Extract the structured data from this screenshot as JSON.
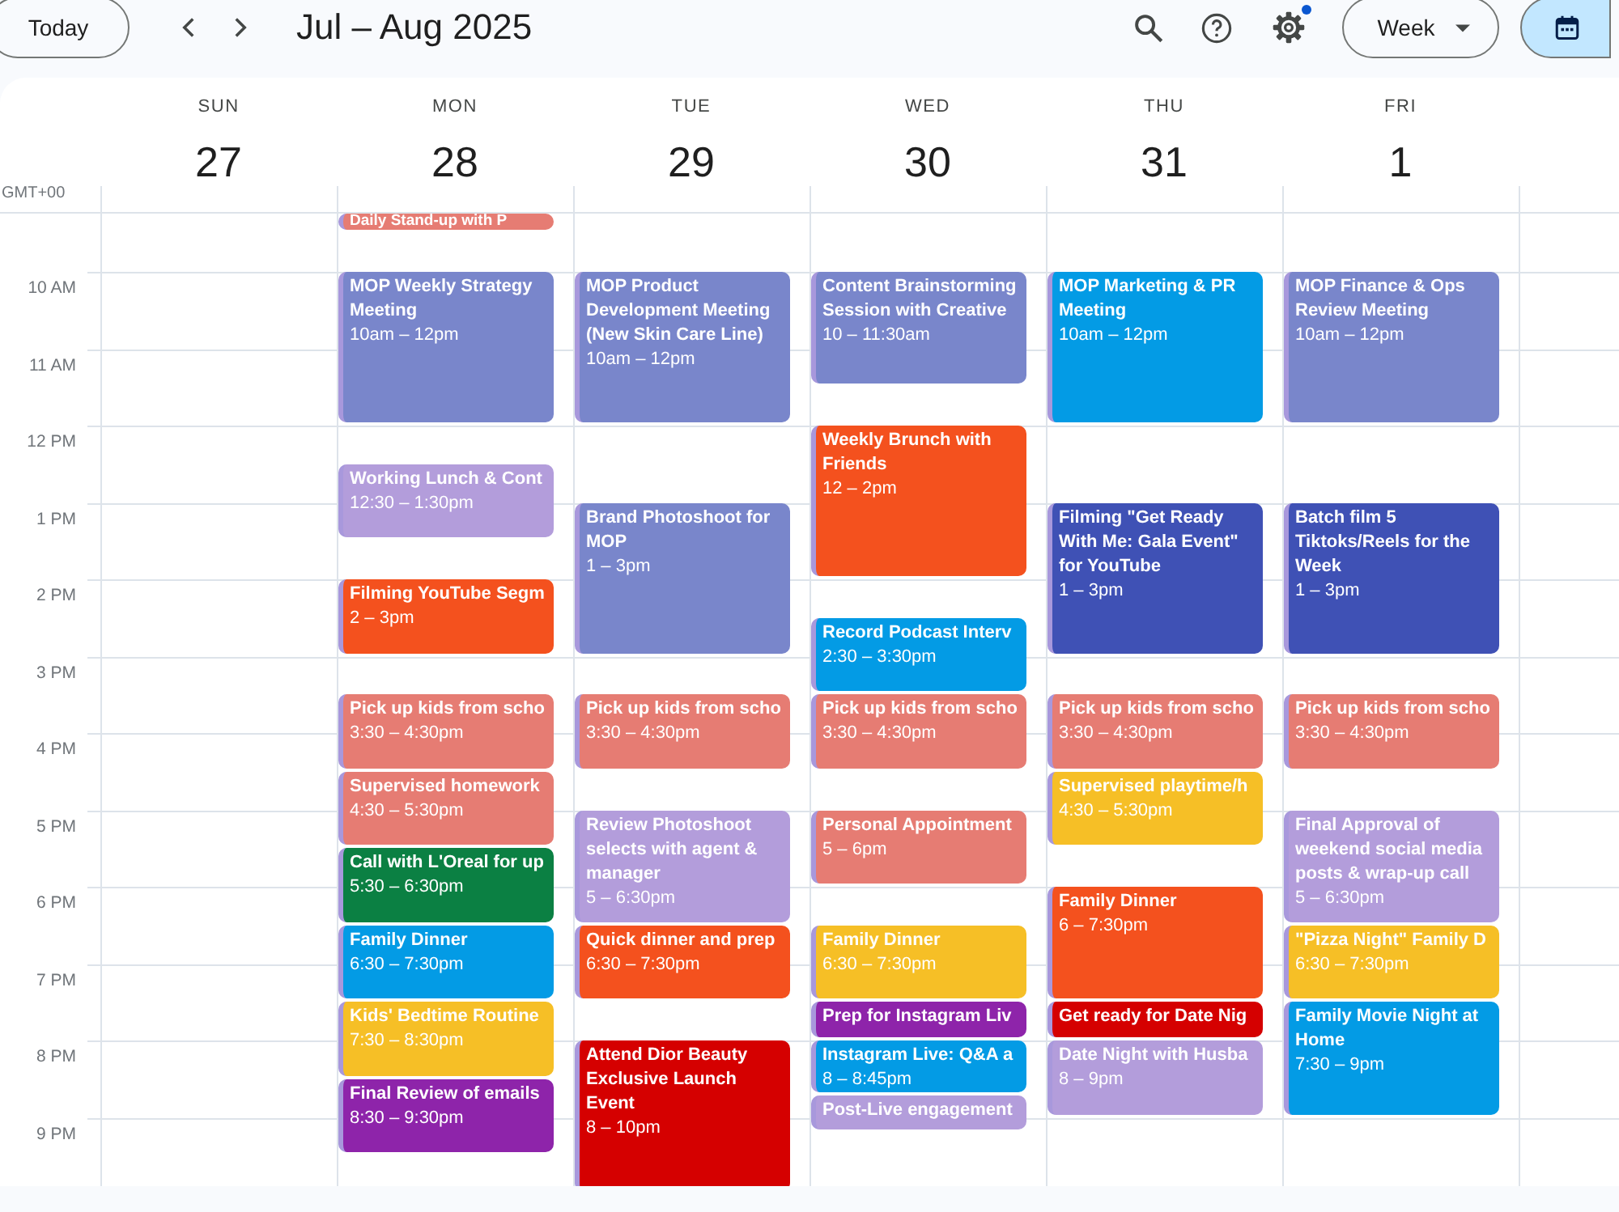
{
  "toolbar": {
    "today_button": "Today",
    "title": "Jul – Aug 2025",
    "view_button": "Week",
    "settings_notification": true,
    "calendar_view": {
      "selected": true
    }
  },
  "timezone": "GMT+00",
  "hours": [
    "10 AM",
    "11 AM",
    "12 PM",
    "1 PM",
    "2 PM",
    "3 PM",
    "4 PM",
    "5 PM",
    "6 PM",
    "7 PM",
    "8 PM",
    "9 PM"
  ],
  "days": [
    {
      "name": "SUN",
      "date": "27"
    },
    {
      "name": "MON",
      "date": "28",
      "events": [
        {
          "title": "Daily Stand-up with P",
          "color": "#e67c73"
        },
        {
          "title": "MOP Weekly Strategy Meeting",
          "time": "10am – 12pm",
          "color": "#7986cb"
        },
        {
          "title": "Working Lunch & Cont",
          "time": "12:30 – 1:30pm",
          "color": "#b39ddb"
        },
        {
          "title": "Filming YouTube Segm",
          "time": "2 – 3pm",
          "color": "#f4511e"
        },
        {
          "title": "Pick up kids from scho",
          "time": "3:30 – 4:30pm",
          "color": "#e67c73"
        },
        {
          "title": "Supervised homework",
          "time": "4:30 – 5:30pm",
          "color": "#e67c73"
        },
        {
          "title": "Call with L'Oreal for up",
          "time": "5:30 – 6:30pm",
          "color": "#0b8043"
        },
        {
          "title": "Family Dinner",
          "time": "6:30 – 7:30pm",
          "color": "#039be5"
        },
        {
          "title": "Kids' Bedtime Routine",
          "time": "7:30 – 8:30pm",
          "color": "#f6bf26"
        },
        {
          "title": "Final Review of emails",
          "time": "8:30 – 9:30pm",
          "color": "#8e24aa"
        }
      ]
    },
    {
      "name": "TUE",
      "date": "29",
      "events": [
        {
          "title": "MOP Product Development Meeting (New Skin Care Line)",
          "time": "10am – 12pm",
          "color": "#7986cb"
        },
        {
          "title": "Brand Photoshoot for MOP",
          "time": "1 – 3pm",
          "color": "#7986cb"
        },
        {
          "title": "Pick up kids from scho",
          "time": "3:30 – 4:30pm",
          "color": "#e67c73"
        },
        {
          "title": "Review Photoshoot selects with agent & manager",
          "time": "5 – 6:30pm",
          "color": "#b39ddb"
        },
        {
          "title": "Quick dinner and prep",
          "time": "6:30 – 7:30pm",
          "color": "#f4511e"
        },
        {
          "title": "Attend Dior Beauty Exclusive Launch Event",
          "time": "8 – 10pm",
          "color": "#d50000"
        }
      ]
    },
    {
      "name": "WED",
      "date": "30",
      "events": [
        {
          "title": "Content Brainstorming Session with Creative",
          "time": "10 – 11:30am",
          "color": "#7986cb"
        },
        {
          "title": "Weekly Brunch with Friends",
          "time": "12 – 2pm",
          "color": "#f4511e"
        },
        {
          "title": "Record Podcast Interv",
          "time": "2:30 – 3:30pm",
          "color": "#039be5"
        },
        {
          "title": "Pick up kids from scho",
          "time": "3:30 – 4:30pm",
          "color": "#e67c73"
        },
        {
          "title": "Personal Appointment",
          "time": "5 – 6pm",
          "color": "#e67c73"
        },
        {
          "title": "Family Dinner",
          "time": "6:30 – 7:30pm",
          "color": "#f6bf26"
        },
        {
          "title": "Prep for Instagram Liv",
          "color": "#8e24aa"
        },
        {
          "title": "Instagram Live: Q&A a",
          "time": "8 – 8:45pm",
          "color": "#039be5"
        },
        {
          "title": "Post-Live engagement",
          "color": "#b39ddb"
        }
      ]
    },
    {
      "name": "THU",
      "date": "31",
      "events": [
        {
          "title": "MOP Marketing & PR Meeting",
          "time": "10am – 12pm",
          "color": "#039be5"
        },
        {
          "title": "Filming \"Get Ready With Me: Gala Event\" for YouTube",
          "time": "1 – 3pm",
          "color": "#3f51b5"
        },
        {
          "title": "Pick up kids from scho",
          "time": "3:30 – 4:30pm",
          "color": "#e67c73"
        },
        {
          "title": "Supervised playtime/h",
          "time": "4:30 – 5:30pm",
          "color": "#f6bf26"
        },
        {
          "title": "Family Dinner",
          "time": "6 – 7:30pm",
          "color": "#f4511e"
        },
        {
          "title": "Get ready for Date Nig",
          "color": "#d50000"
        },
        {
          "title": "Date Night with Husba",
          "time": "8 – 9pm",
          "color": "#b39ddb"
        }
      ]
    },
    {
      "name": "FRI",
      "date": "1",
      "events": [
        {
          "title": "MOP Finance & Ops Review Meeting",
          "time": "10am – 12pm",
          "color": "#7986cb"
        },
        {
          "title": "Batch film 5 Tiktoks/Reels for the Week",
          "time": "1 – 3pm",
          "color": "#3f51b5"
        },
        {
          "title": "Pick up kids from scho",
          "time": "3:30 – 4:30pm",
          "color": "#e67c73"
        },
        {
          "title": "Final Approval of weekend social media posts & wrap-up call",
          "time": "5 – 6:30pm",
          "color": "#b39ddb"
        },
        {
          "title": "\"Pizza Night\" Family D",
          "time": "6:30 – 7:30pm",
          "color": "#f6bf26"
        },
        {
          "title": "Family Movie Night at Home",
          "time": "7:30 – 9pm",
          "color": "#039be5"
        }
      ]
    }
  ]
}
